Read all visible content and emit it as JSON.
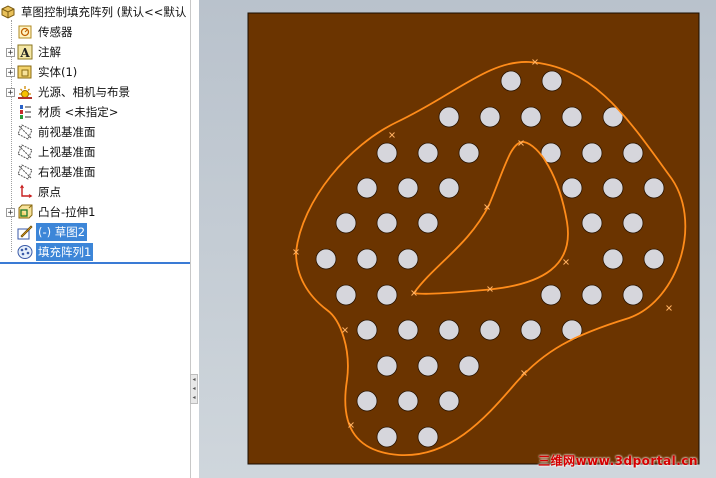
{
  "feature_tree": {
    "root": {
      "label": "草图控制填充阵列 (默认<<默认",
      "icon": "part-icon"
    },
    "items": [
      {
        "label": "传感器",
        "icon": "sensor-icon",
        "expandable": false
      },
      {
        "label": "注解",
        "icon": "annotation-icon",
        "expandable": true
      },
      {
        "label": "实体(1)",
        "icon": "solid-body-icon",
        "expandable": true
      },
      {
        "label": "光源、相机与布景",
        "icon": "lights-camera-icon",
        "expandable": true
      },
      {
        "label": "材质 <未指定>",
        "icon": "material-icon",
        "expandable": false
      },
      {
        "label": "前视基准面",
        "icon": "plane-icon",
        "expandable": false
      },
      {
        "label": "上视基准面",
        "icon": "plane-icon",
        "expandable": false
      },
      {
        "label": "右视基准面",
        "icon": "plane-icon",
        "expandable": false
      },
      {
        "label": "原点",
        "icon": "origin-icon",
        "expandable": false
      },
      {
        "label": "凸台-拉伸1",
        "icon": "extrude-icon",
        "expandable": true
      },
      {
        "label": "(-) 草图2",
        "icon": "sketch-icon",
        "expandable": false,
        "selected": true
      },
      {
        "label": "填充阵列1",
        "icon": "fill-pattern-icon",
        "expandable": false,
        "selected": true
      }
    ]
  },
  "graphics": {
    "plate_color": "#6b3400",
    "hole_color": "#d6d6dc",
    "boundary_color": "#ff8c1a",
    "hole_count": 56
  },
  "watermark": "三维网www.3dportal.cn",
  "colors": {
    "selection": "#3d86d8",
    "background_top": "#b9c2cc"
  }
}
